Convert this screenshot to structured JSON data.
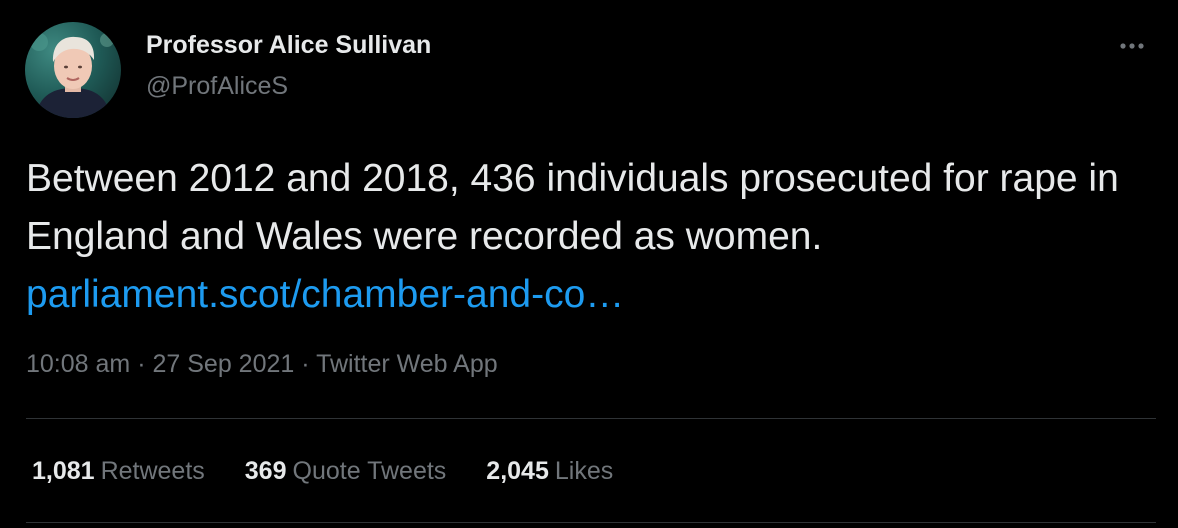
{
  "author": {
    "display_name": "Professor Alice Sullivan",
    "handle": "@ProfAliceS"
  },
  "tweet": {
    "text": "Between 2012 and 2018, 436 individuals prosecuted for rape in England and Wales were recorded as women. ",
    "link_text": "parliament.scot/chamber-and-co…"
  },
  "meta": {
    "time": "10:08 am",
    "separator": "·",
    "date": "27 Sep 2021",
    "source": "Twitter Web App"
  },
  "stats": {
    "retweets_count": "1,081",
    "retweets_label": "Retweets",
    "quotes_count": "369",
    "quotes_label": "Quote Tweets",
    "likes_count": "2,045",
    "likes_label": "Likes"
  },
  "icons": {
    "more": "more-horizontal-icon"
  },
  "colors": {
    "background": "#000000",
    "primary_text": "#e7e9ea",
    "secondary_text": "#71767b",
    "link": "#1d9bf0",
    "divider": "#2f3336"
  }
}
